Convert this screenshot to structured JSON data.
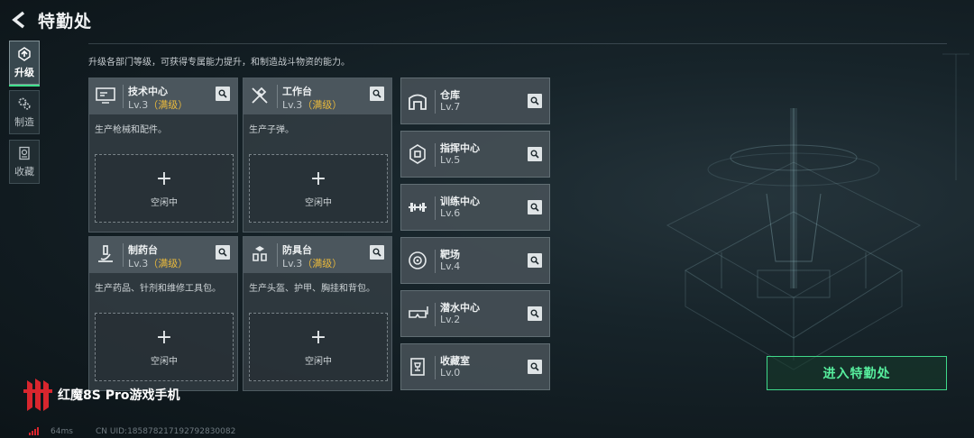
{
  "header": {
    "title": "特勤处"
  },
  "nav": [
    {
      "label": "升级",
      "icon": "upgrade-icon",
      "active": true
    },
    {
      "label": "制造",
      "icon": "gears-icon",
      "active": false
    },
    {
      "label": "收藏",
      "icon": "collection-icon",
      "active": false
    }
  ],
  "description": "升级各部门等级，可获得专属能力提升，和制造战斗物资的能力。",
  "facilities": [
    {
      "name": "技术中心",
      "level": "Lv.3",
      "max": "（满级）",
      "desc": "生产枪械和配件。",
      "slot_label": "空闲中",
      "icon": "monitor-icon"
    },
    {
      "name": "工作台",
      "level": "Lv.3",
      "max": "（满级）",
      "desc": "生产子弹。",
      "slot_label": "空闲中",
      "icon": "tools-icon"
    },
    {
      "name": "制药台",
      "level": "Lv.3",
      "max": "（满级）",
      "desc": "生产药品、针剂和维修工具包。",
      "slot_label": "空闲中",
      "icon": "microscope-icon"
    },
    {
      "name": "防具台",
      "level": "Lv.3",
      "max": "（满级）",
      "desc": "生产头盔、护甲、胸挂和背包。",
      "slot_label": "空闲中",
      "icon": "armor-icon"
    }
  ],
  "departments": [
    {
      "name": "仓库",
      "level": "Lv.7",
      "icon": "warehouse-icon"
    },
    {
      "name": "指挥中心",
      "level": "Lv.5",
      "icon": "chip-icon"
    },
    {
      "name": "训练中心",
      "level": "Lv.6",
      "icon": "dumbbell-icon"
    },
    {
      "name": "靶场",
      "level": "Lv.4",
      "icon": "target-icon"
    },
    {
      "name": "潜水中心",
      "level": "Lv.2",
      "icon": "diving-mask-icon"
    },
    {
      "name": "收藏室",
      "level": "Lv.0",
      "icon": "trophy-case-icon"
    }
  ],
  "enter_button": "进入特勤处",
  "watermark": "红魔8S Pro游戏手机",
  "footer": {
    "ping": "64ms",
    "uid": "CN UID:1858782171927928300​82"
  },
  "colors": {
    "accent_green": "#3fe08c",
    "max_level": "#e9b93c"
  }
}
